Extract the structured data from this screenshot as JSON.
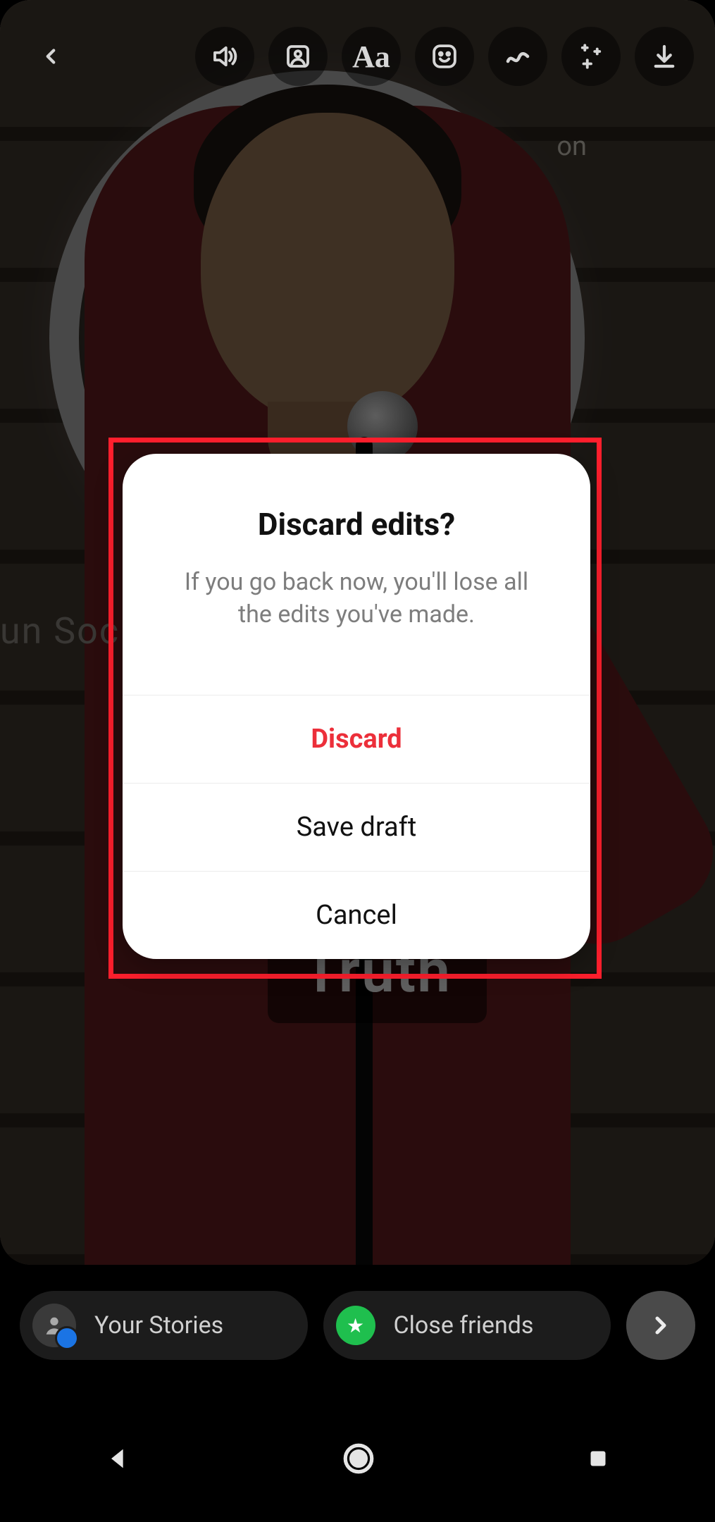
{
  "toolbar": {
    "back_name": "back-icon",
    "sound_name": "sound-icon",
    "mention_name": "mention-icon",
    "text_name": "text-tool-icon",
    "text_label": "Aa",
    "sticker_name": "sticker-icon",
    "draw_name": "draw-icon",
    "effects_name": "effects-icon",
    "download_name": "download-icon"
  },
  "background": {
    "watermark_left": "un Soc",
    "label_right": "on",
    "caption_word": "Truth"
  },
  "sharebar": {
    "your_stories_label": "Your Stories",
    "close_friends_label": "Close friends"
  },
  "modal": {
    "title": "Discard edits?",
    "message": "If you go back now, you'll lose all the edits you've made.",
    "discard_label": "Discard",
    "save_draft_label": "Save draft",
    "cancel_label": "Cancel"
  }
}
